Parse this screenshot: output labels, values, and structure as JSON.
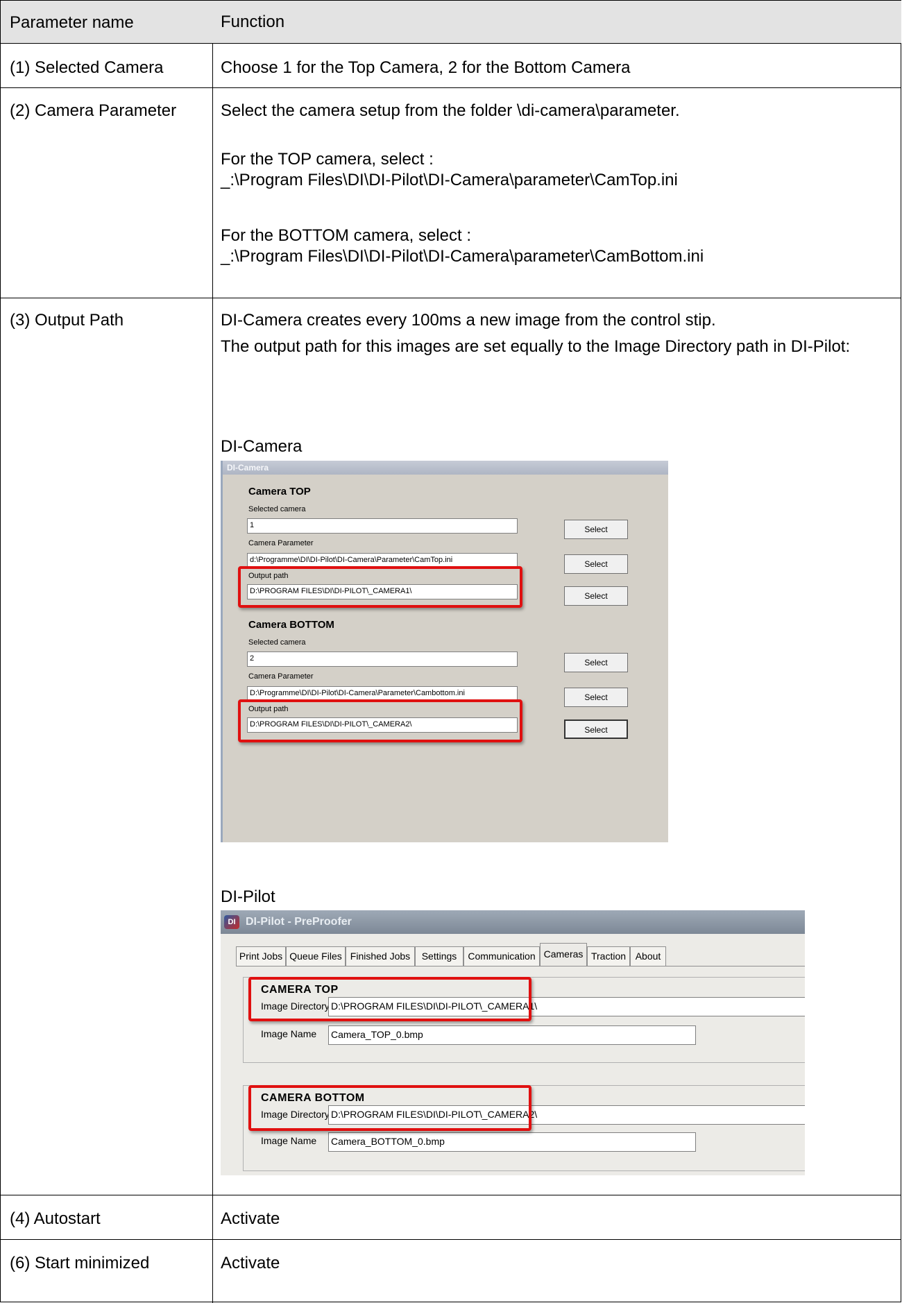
{
  "table": {
    "header": {
      "name": "Parameter name",
      "function": "Function"
    },
    "rows": [
      {
        "name": "(1) Selected Camera",
        "function": [
          "Choose 1 for the Top Camera, 2 for the Bottom Camera"
        ]
      },
      {
        "name": "(2) Camera Parameter",
        "function": [
          "Select the camera setup from the folder \\di-camera\\parameter.",
          "For the TOP camera, select :",
          "_:\\Program Files\\DI\\DI-Pilot\\DI-Camera\\parameter\\CamTop.ini",
          "For the BOTTOM camera, select :",
          "_:\\Program Files\\DI\\DI-Pilot\\DI-Camera\\parameter\\CamBottom.ini"
        ]
      },
      {
        "name": "(3) Output Path",
        "function": [
          "DI-Camera creates every 100ms a new image from the control stip.",
          "The output path for this images are set equally to the Image Directory path in DI-Pilot:",
          "DI-Camera",
          "DI-Pilot"
        ]
      },
      {
        "name": "(4) Autostart",
        "function": [
          "Activate"
        ]
      },
      {
        "name": "(6) Start minimized",
        "function": [
          "Activate"
        ]
      }
    ]
  },
  "dicamera": {
    "title": "DI-Camera",
    "select_label": "Select",
    "top": {
      "header": "Camera TOP",
      "selected_label": "Selected camera",
      "selected_value": "1",
      "param_label": "Camera Parameter",
      "param_value": "d:\\Programme\\DI\\DI-Pilot\\DI-Camera\\Parameter\\CamTop.ini",
      "output_label": "Output path",
      "output_value": "D:\\PROGRAM FILES\\DI\\DI-PILOT\\_CAMERA1\\"
    },
    "bottom": {
      "header": "Camera BOTTOM",
      "selected_label": "Selected camera",
      "selected_value": "2",
      "param_label": "Camera Parameter",
      "param_value": "D:\\Programme\\DI\\DI-Pilot\\DI-Camera\\Parameter\\Cambottom.ini",
      "output_label": "Output path",
      "output_value": "D:\\PROGRAM FILES\\DI\\DI-PILOT\\_CAMERA2\\"
    }
  },
  "dipilot": {
    "title": "DI-Pilot - PreProofer",
    "icon_text": "DI",
    "tabs": [
      "Print Jobs",
      "Queue Files",
      "Finished Jobs",
      "Settings",
      "Communication",
      "Cameras",
      "Traction",
      "About"
    ],
    "active_tab": "Cameras",
    "top": {
      "header": "CAMERA TOP",
      "dir_label": "Image Directory",
      "dir_value": "D:\\PROGRAM FILES\\DI\\DI-PILOT\\_CAMERA1\\",
      "name_label": "Image Name",
      "name_value": "Camera_TOP_0.bmp"
    },
    "bottom": {
      "header": "CAMERA BOTTOM",
      "dir_label": "Image Directory",
      "dir_value": "D:\\PROGRAM FILES\\DI\\DI-PILOT\\_CAMERA2\\",
      "name_label": "Image Name",
      "name_value": "Camera_BOTTOM_0.bmp"
    }
  },
  "colors": {
    "highlight": "#e01010",
    "header_bg": "#e3e3e3",
    "dialog_bg": "#d4d0c8"
  }
}
